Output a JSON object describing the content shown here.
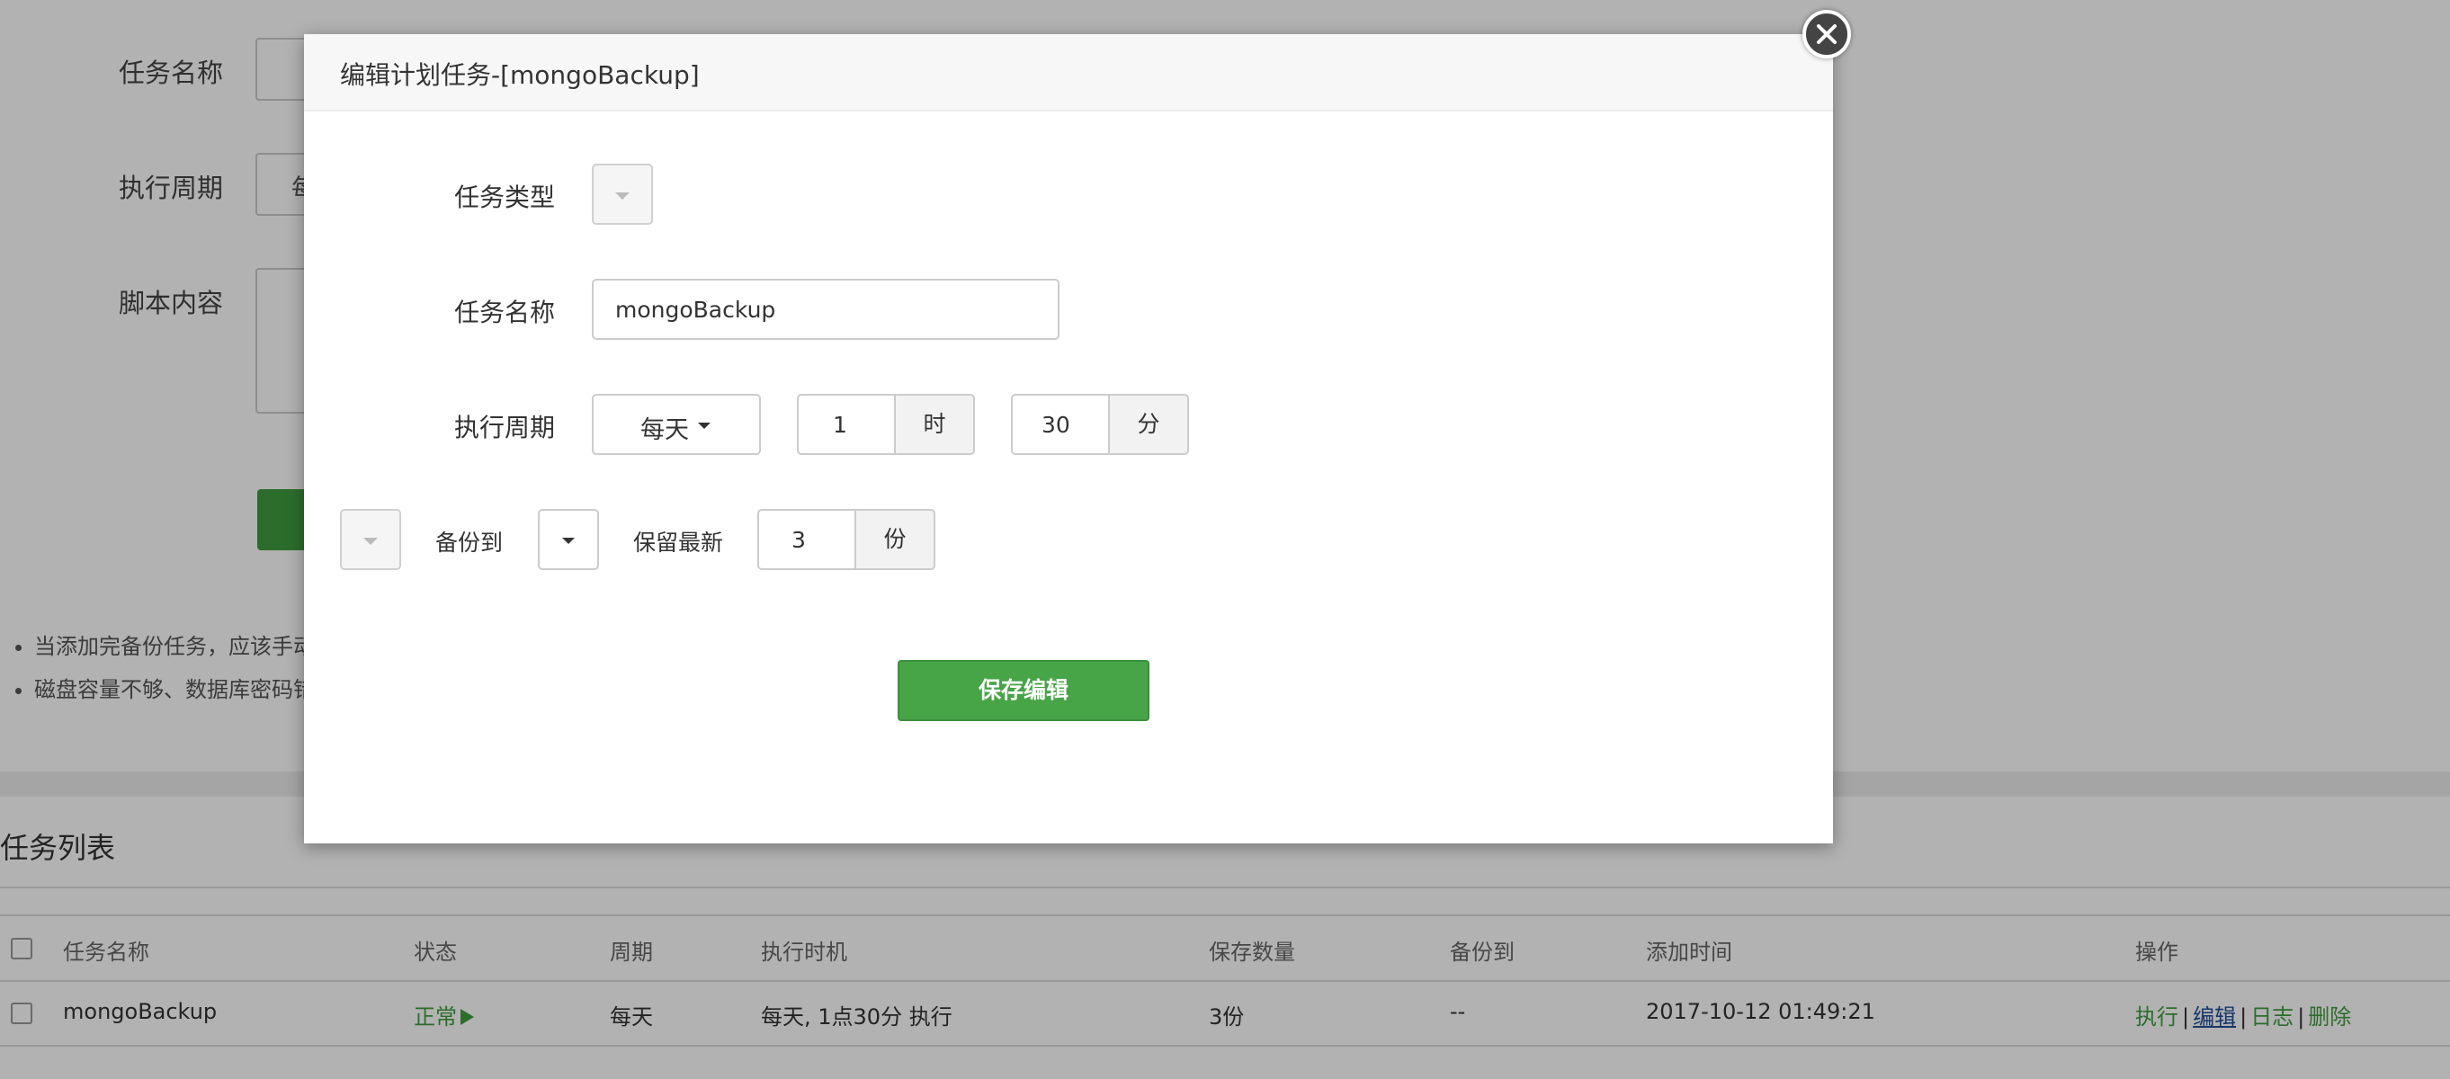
{
  "background": {
    "form": {
      "task_name_label": "任务名称",
      "cycle_label": "执行周期",
      "cycle_value_partial": "每",
      "script_label": "脚本内容"
    },
    "tips": [
      "当添加完备份任务，应该手动",
      "磁盘容量不够、数据库密码错"
    ],
    "task_list": {
      "title": "任务列表",
      "columns": [
        "任务名称",
        "状态",
        "周期",
        "执行时机",
        "保存数量",
        "备份到",
        "添加时间",
        "操作"
      ],
      "rows": [
        {
          "name": "mongoBackup",
          "status": "正常",
          "status_icon": "play-icon",
          "cycle": "每天",
          "timing": "每天, 1点30分 执行",
          "keep_count": "3份",
          "backup_to": "--",
          "added_time": "2017-10-12 01:49:21",
          "actions": {
            "run": "执行",
            "edit": "编辑",
            "log": "日志",
            "delete": "删除",
            "separator": "|"
          }
        }
      ]
    }
  },
  "modal": {
    "title": "编辑计划任务-[mongoBackup]",
    "close_icon": "close-icon",
    "task_type_label": "任务类型",
    "task_name_label": "任务名称",
    "task_name_value": "mongoBackup",
    "cycle_label": "执行周期",
    "cycle_select_value": "每天",
    "hour_value": "1",
    "hour_unit": "时",
    "minute_value": "30",
    "minute_unit": "分",
    "backup_to_label": "备份到",
    "keep_latest_label": "保留最新",
    "keep_value": "3",
    "keep_unit": "份",
    "save_button": "保存编辑"
  },
  "colors": {
    "accent_green": "#47a447",
    "status_green": "#3f9d3f",
    "edit_link": "#1f4f99",
    "overlay": "rgba(0,0,0,0.30)"
  }
}
